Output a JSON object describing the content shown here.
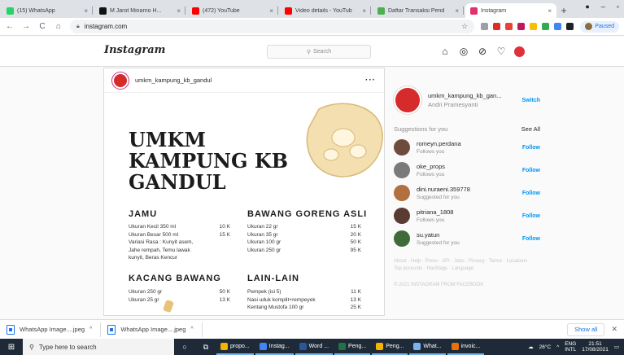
{
  "browser": {
    "tabs": [
      {
        "title": "(15) WhatsApp",
        "fav": "#25d366",
        "active": false
      },
      {
        "title": "M Jarot Minarno H...",
        "fav": "#111111",
        "active": false
      },
      {
        "title": "(472) YouTube",
        "fav": "#ff0000",
        "active": false
      },
      {
        "title": "Video details - YouTub",
        "fav": "#ff0000",
        "active": false
      },
      {
        "title": "Daftar Transaksi Pend",
        "fav": "#4caf50",
        "active": false
      },
      {
        "title": "Instagram",
        "fav": "#e1306c",
        "active": true
      }
    ],
    "url": "instagram.com",
    "profile_label": "Paused"
  },
  "instagram": {
    "logo": "Instagram",
    "search_placeholder": "Search",
    "post": {
      "username": "umkm_kampung_kb_gandul",
      "menu_title": [
        "UMKM",
        "KAMPUNG KB",
        "GANDUL"
      ],
      "sections": [
        {
          "title": "JAMU",
          "items": [
            {
              "name": "Ukuran Kecil 350 ml",
              "price": "10 K"
            },
            {
              "name": "Ukuran Besar 500 ml",
              "price": "15 K"
            },
            {
              "name": "Variasi Rasa : Kunyit asem,",
              "price": ""
            },
            {
              "name": "Jahe rempah, Temu lawak",
              "price": ""
            },
            {
              "name": "kunyit, Beras Kencur",
              "price": ""
            }
          ]
        },
        {
          "title": "BAWANG GORENG ASLI",
          "items": [
            {
              "name": "Ukuran 22 gr",
              "price": "15 K"
            },
            {
              "name": "Ukuran 35 gr",
              "price": "20 K"
            },
            {
              "name": "Ukuran 100 gr",
              "price": "50 K"
            },
            {
              "name": "Ukuran 250 gr",
              "price": "95 K"
            }
          ]
        },
        {
          "title": "KACANG BAWANG",
          "items": [
            {
              "name": "Ukuran 250 gr",
              "price": "50 K"
            },
            {
              "name": "Ukuran 25 gr",
              "price": "13 K"
            }
          ]
        },
        {
          "title": "LAIN-LAIN",
          "items": [
            {
              "name": "Pempek (isi 5)",
              "price": "11 K"
            },
            {
              "name": "Nasi uduk komplit+rempeyek",
              "price": "13 K"
            },
            {
              "name": "Kentang Mustofa 100 gr",
              "price": "25 K"
            }
          ]
        }
      ]
    },
    "sidebar": {
      "username": "umkm_kampung_kb_gan...",
      "fullname": "Andri Pramesyanti",
      "switch_label": "Switch",
      "suggestions_title": "Suggestions for you",
      "see_all": "See All",
      "suggestions": [
        {
          "user": "romeyn.perdana",
          "sub": "Follows you",
          "color": "#6d4c3d"
        },
        {
          "user": "oke_props",
          "sub": "Follows you",
          "color": "#7a7a7a"
        },
        {
          "user": "dini.nuraeni.359778",
          "sub": "Suggested for you",
          "color": "#b07040"
        },
        {
          "user": "pitriana_1808",
          "sub": "Follows you",
          "color": "#5a3b34"
        },
        {
          "user": "su.yatun",
          "sub": "Suggested for you",
          "color": "#3f6b3a"
        }
      ],
      "follow_label": "Follow",
      "footer_links": "About · Help · Press · API · Jobs · Privacy · Terms · Locations · Top accounts · Hashtags · Language",
      "copyright": "© 2021 INSTAGRAM FROM FACEBOOK"
    }
  },
  "downloads": {
    "items": [
      "WhatsApp Image....jpeg",
      "WhatsApp Image....jpeg"
    ],
    "show_all": "Show all"
  },
  "taskbar": {
    "search_placeholder": "Type here to search",
    "apps": [
      {
        "label": "propo...",
        "color": "#f4b400"
      },
      {
        "label": "Instag...",
        "color": "#4285f4"
      },
      {
        "label": "Word ...",
        "color": "#2b579a"
      },
      {
        "label": "Peng...",
        "color": "#217346"
      },
      {
        "label": "Peng...",
        "color": "#f4b400"
      },
      {
        "label": "What...",
        "color": "#7ab3ef"
      },
      {
        "label": "invoic...",
        "color": "#e8710a"
      }
    ],
    "weather": "26°C",
    "lang": "ENG",
    "lang_sub": "INTL",
    "time": "21:51",
    "date": "17/08/2021"
  }
}
